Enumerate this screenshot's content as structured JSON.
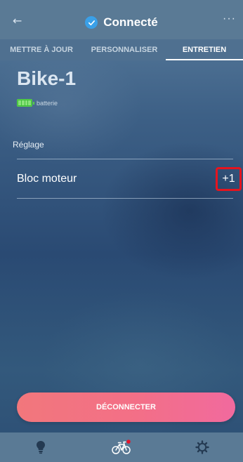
{
  "header": {
    "title": "Connecté",
    "back_icon": "arrow-left-icon",
    "status_icon": "check-circle-icon",
    "more_icon": "more-horizontal-icon",
    "more_glyph": "···"
  },
  "tabs": [
    {
      "label": "METTRE À JOUR",
      "active": false
    },
    {
      "label": "PERSONNALISER",
      "active": false
    },
    {
      "label": "ENTRETIEN",
      "active": true
    }
  ],
  "device": {
    "name": "Bike-1",
    "battery_label": "batterie",
    "battery_icon": "battery-full-icon"
  },
  "maintenance": {
    "section_title": "Réglage",
    "items": [
      {
        "label": "Bloc moteur",
        "count": "+1"
      }
    ]
  },
  "actions": {
    "disconnect_label": "DÉCONNECTER"
  },
  "bottom_nav": [
    {
      "icon": "lightbulb-icon",
      "active": false
    },
    {
      "icon": "bike-icon",
      "active": true,
      "badge": true
    },
    {
      "icon": "settings-gear-icon",
      "active": false
    }
  ],
  "colors": {
    "accent_check": "#3aa0e8",
    "highlight_border": "#e6141e",
    "button_gradient_start": "#f2777c",
    "button_gradient_end": "#f16a9e",
    "badge_dot": "#e8142a",
    "battery_green": "#3fbf3a"
  }
}
